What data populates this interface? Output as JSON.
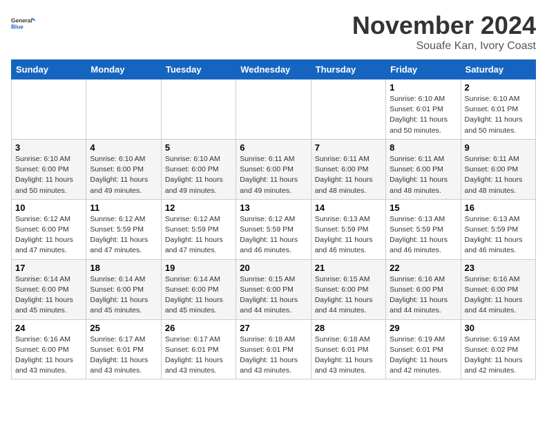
{
  "logo": {
    "text_general": "General",
    "text_blue": "Blue"
  },
  "title": "November 2024",
  "location": "Souafe Kan, Ivory Coast",
  "headers": [
    "Sunday",
    "Monday",
    "Tuesday",
    "Wednesday",
    "Thursday",
    "Friday",
    "Saturday"
  ],
  "weeks": [
    [
      {
        "day": "",
        "info": ""
      },
      {
        "day": "",
        "info": ""
      },
      {
        "day": "",
        "info": ""
      },
      {
        "day": "",
        "info": ""
      },
      {
        "day": "",
        "info": ""
      },
      {
        "day": "1",
        "info": "Sunrise: 6:10 AM\nSunset: 6:01 PM\nDaylight: 11 hours\nand 50 minutes."
      },
      {
        "day": "2",
        "info": "Sunrise: 6:10 AM\nSunset: 6:01 PM\nDaylight: 11 hours\nand 50 minutes."
      }
    ],
    [
      {
        "day": "3",
        "info": "Sunrise: 6:10 AM\nSunset: 6:00 PM\nDaylight: 11 hours\nand 50 minutes."
      },
      {
        "day": "4",
        "info": "Sunrise: 6:10 AM\nSunset: 6:00 PM\nDaylight: 11 hours\nand 49 minutes."
      },
      {
        "day": "5",
        "info": "Sunrise: 6:10 AM\nSunset: 6:00 PM\nDaylight: 11 hours\nand 49 minutes."
      },
      {
        "day": "6",
        "info": "Sunrise: 6:11 AM\nSunset: 6:00 PM\nDaylight: 11 hours\nand 49 minutes."
      },
      {
        "day": "7",
        "info": "Sunrise: 6:11 AM\nSunset: 6:00 PM\nDaylight: 11 hours\nand 48 minutes."
      },
      {
        "day": "8",
        "info": "Sunrise: 6:11 AM\nSunset: 6:00 PM\nDaylight: 11 hours\nand 48 minutes."
      },
      {
        "day": "9",
        "info": "Sunrise: 6:11 AM\nSunset: 6:00 PM\nDaylight: 11 hours\nand 48 minutes."
      }
    ],
    [
      {
        "day": "10",
        "info": "Sunrise: 6:12 AM\nSunset: 6:00 PM\nDaylight: 11 hours\nand 47 minutes."
      },
      {
        "day": "11",
        "info": "Sunrise: 6:12 AM\nSunset: 5:59 PM\nDaylight: 11 hours\nand 47 minutes."
      },
      {
        "day": "12",
        "info": "Sunrise: 6:12 AM\nSunset: 5:59 PM\nDaylight: 11 hours\nand 47 minutes."
      },
      {
        "day": "13",
        "info": "Sunrise: 6:12 AM\nSunset: 5:59 PM\nDaylight: 11 hours\nand 46 minutes."
      },
      {
        "day": "14",
        "info": "Sunrise: 6:13 AM\nSunset: 5:59 PM\nDaylight: 11 hours\nand 46 minutes."
      },
      {
        "day": "15",
        "info": "Sunrise: 6:13 AM\nSunset: 5:59 PM\nDaylight: 11 hours\nand 46 minutes."
      },
      {
        "day": "16",
        "info": "Sunrise: 6:13 AM\nSunset: 5:59 PM\nDaylight: 11 hours\nand 46 minutes."
      }
    ],
    [
      {
        "day": "17",
        "info": "Sunrise: 6:14 AM\nSunset: 6:00 PM\nDaylight: 11 hours\nand 45 minutes."
      },
      {
        "day": "18",
        "info": "Sunrise: 6:14 AM\nSunset: 6:00 PM\nDaylight: 11 hours\nand 45 minutes."
      },
      {
        "day": "19",
        "info": "Sunrise: 6:14 AM\nSunset: 6:00 PM\nDaylight: 11 hours\nand 45 minutes."
      },
      {
        "day": "20",
        "info": "Sunrise: 6:15 AM\nSunset: 6:00 PM\nDaylight: 11 hours\nand 44 minutes."
      },
      {
        "day": "21",
        "info": "Sunrise: 6:15 AM\nSunset: 6:00 PM\nDaylight: 11 hours\nand 44 minutes."
      },
      {
        "day": "22",
        "info": "Sunrise: 6:16 AM\nSunset: 6:00 PM\nDaylight: 11 hours\nand 44 minutes."
      },
      {
        "day": "23",
        "info": "Sunrise: 6:16 AM\nSunset: 6:00 PM\nDaylight: 11 hours\nand 44 minutes."
      }
    ],
    [
      {
        "day": "24",
        "info": "Sunrise: 6:16 AM\nSunset: 6:00 PM\nDaylight: 11 hours\nand 43 minutes."
      },
      {
        "day": "25",
        "info": "Sunrise: 6:17 AM\nSunset: 6:01 PM\nDaylight: 11 hours\nand 43 minutes."
      },
      {
        "day": "26",
        "info": "Sunrise: 6:17 AM\nSunset: 6:01 PM\nDaylight: 11 hours\nand 43 minutes."
      },
      {
        "day": "27",
        "info": "Sunrise: 6:18 AM\nSunset: 6:01 PM\nDaylight: 11 hours\nand 43 minutes."
      },
      {
        "day": "28",
        "info": "Sunrise: 6:18 AM\nSunset: 6:01 PM\nDaylight: 11 hours\nand 43 minutes."
      },
      {
        "day": "29",
        "info": "Sunrise: 6:19 AM\nSunset: 6:01 PM\nDaylight: 11 hours\nand 42 minutes."
      },
      {
        "day": "30",
        "info": "Sunrise: 6:19 AM\nSunset: 6:02 PM\nDaylight: 11 hours\nand 42 minutes."
      }
    ]
  ]
}
